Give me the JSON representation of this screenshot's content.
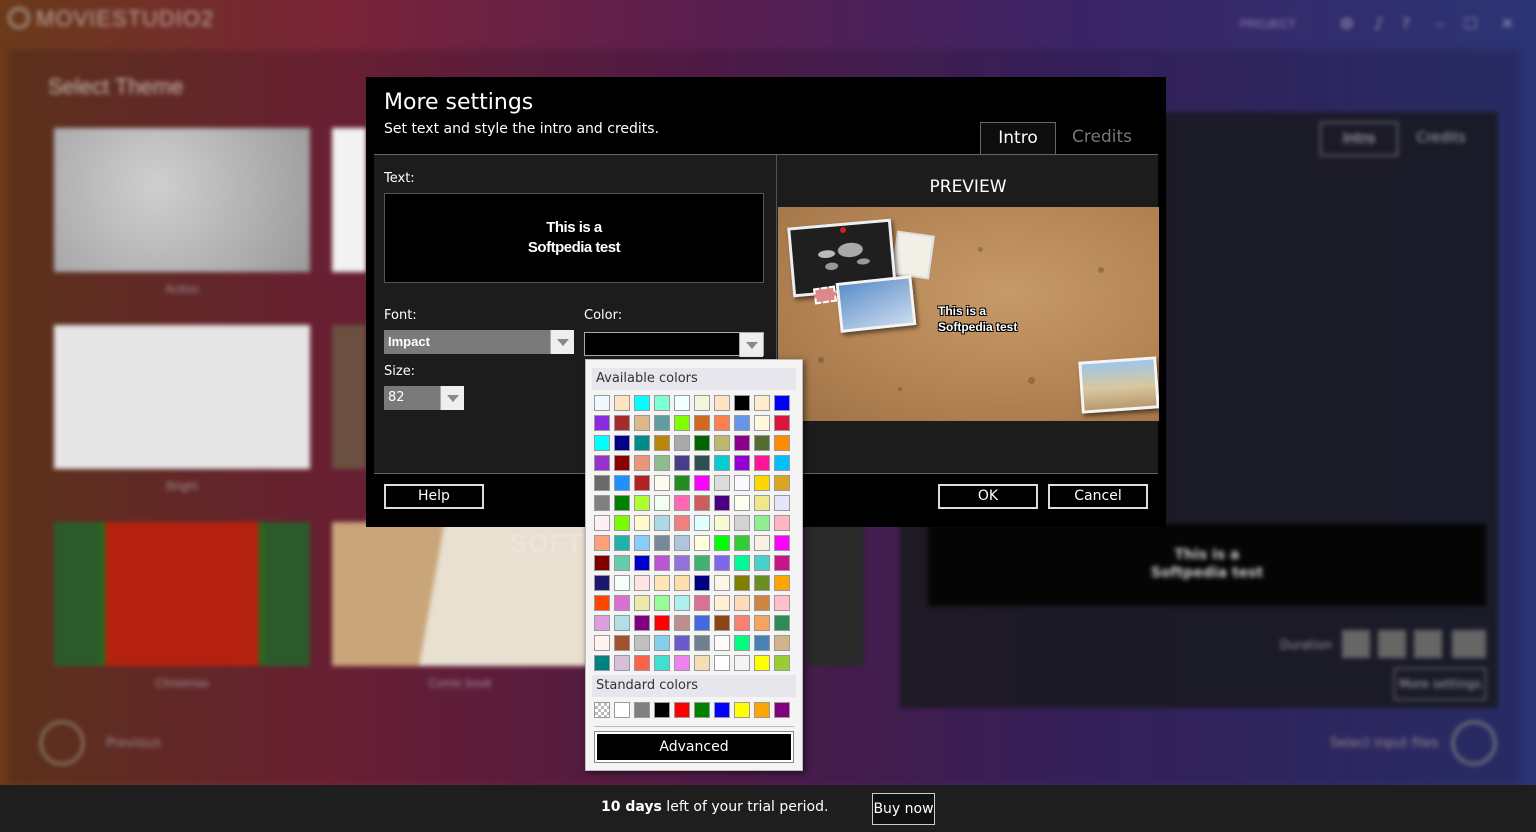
{
  "background_app": {
    "logo": "MOVIESTUDIO2",
    "project_label": "PROJECT",
    "select_theme": "Select Theme",
    "themes": [
      {
        "label": "Action"
      },
      {
        "label": "Bright"
      },
      {
        "label": "Christmas"
      },
      {
        "label": "Comic book"
      }
    ],
    "right_tabs": [
      "Intro",
      "Credits"
    ],
    "preview_text_line1": "This is a",
    "preview_text_line2": "Softpedia test",
    "duration_label": "Duration",
    "more_settings_button": "More settings",
    "previous_label": "Previous",
    "select_input_files": "Select input files"
  },
  "dialog": {
    "title": "More settings",
    "subtitle": "Set text and style the intro and credits.",
    "tabs": {
      "intro": "Intro",
      "credits": "Credits"
    },
    "text_label": "Text:",
    "text_line1": "This is a",
    "text_line2": "Softpedia test",
    "font_label": "Font:",
    "font_value": "Impact",
    "color_label": "Color:",
    "color_value": "#000000",
    "size_label": "Size:",
    "size_value": "82",
    "preview_label": "PREVIEW",
    "preview_text_line1": "This is a",
    "preview_text_line2": "Softpedia test",
    "help_button": "Help",
    "ok_button": "OK",
    "cancel_button": "Cancel"
  },
  "color_popup": {
    "available_label": "Available colors",
    "standard_label": "Standard colors",
    "advanced_button": "Advanced",
    "available_colors": [
      "#f0f8ff",
      "#ffe4c4",
      "#00ffff",
      "#7fffd4",
      "#f0ffff",
      "#f5f5dc",
      "#ffe4c4",
      "#000000",
      "#ffebcd",
      "#0000ff",
      "#8a2be2",
      "#a52a2a",
      "#deb887",
      "#5f9ea0",
      "#7fff00",
      "#d2691e",
      "#ff7f50",
      "#6495ed",
      "#fff8dc",
      "#dc143c",
      "#00ffff",
      "#00008b",
      "#008b8b",
      "#b8860b",
      "#a9a9a9",
      "#006400",
      "#bdb76b",
      "#8b008b",
      "#556b2f",
      "#ff8c00",
      "#9932cc",
      "#8b0000",
      "#e9967a",
      "#8fbc8f",
      "#483d8b",
      "#2f4f4f",
      "#00ced1",
      "#9400d3",
      "#ff1493",
      "#00bfff",
      "#696969",
      "#1e90ff",
      "#b22222",
      "#fffaf0",
      "#228b22",
      "#ff00ff",
      "#dcdcdc",
      "#f8f8ff",
      "#ffd700",
      "#daa520",
      "#808080",
      "#008000",
      "#adff2f",
      "#f0fff0",
      "#ff69b4",
      "#cd5c5c",
      "#4b0082",
      "#fffff0",
      "#f0e68c",
      "#e6e6fa",
      "#fff0f5",
      "#7cfc00",
      "#fffacd",
      "#add8e6",
      "#f08080",
      "#e0ffff",
      "#fafad2",
      "#d3d3d3",
      "#90ee90",
      "#ffb6c1",
      "#ffa07a",
      "#20b2aa",
      "#87cefa",
      "#778899",
      "#b0c4de",
      "#ffffe0",
      "#00ff00",
      "#32cd32",
      "#faf0e6",
      "#ff00ff",
      "#800000",
      "#66cdaa",
      "#0000cd",
      "#ba55d3",
      "#9370db",
      "#3cb371",
      "#7b68ee",
      "#00fa9a",
      "#48d1cc",
      "#c71585",
      "#191970",
      "#f5fffa",
      "#ffe4e1",
      "#ffe4b5",
      "#ffdead",
      "#000080",
      "#fdf5e6",
      "#808000",
      "#6b8e23",
      "#ffa500",
      "#ff4500",
      "#da70d6",
      "#eee8aa",
      "#98fb98",
      "#afeeee",
      "#db7093",
      "#ffefd5",
      "#ffdab9",
      "#cd853f",
      "#ffc0cb",
      "#dda0dd",
      "#b0e0e6",
      "#800080",
      "#ff0000",
      "#bc8f8f",
      "#4169e1",
      "#8b4513",
      "#fa8072",
      "#f4a460",
      "#2e8b57",
      "#fff5ee",
      "#a0522d",
      "#c0c0c0",
      "#87ceeb",
      "#6a5acd",
      "#708090",
      "#fffafa",
      "#00ff7f",
      "#4682b4",
      "#d2b48c",
      "#008080",
      "#d8bfd8",
      "#ff6347",
      "#40e0d0",
      "#ee82ee",
      "#f5deb3",
      "#ffffff",
      "#f5f5f5",
      "#ffff00",
      "#9acd32"
    ],
    "standard_colors": [
      "transparent",
      "#ffffff",
      "#808080",
      "#000000",
      "#ff0000",
      "#008000",
      "#0000ff",
      "#ffff00",
      "#ffa500",
      "#800080"
    ]
  },
  "watermark": "SOFTPEDIA",
  "trial_bar": {
    "days": "10 days",
    "rest": " left of your trial period.",
    "buy_button": "Buy now"
  }
}
